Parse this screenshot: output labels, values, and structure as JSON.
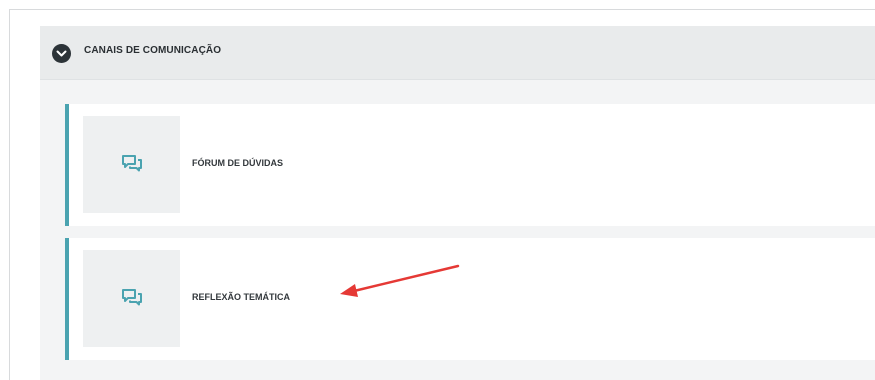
{
  "section": {
    "title": "CANAIS DE COMUNICAÇÃO",
    "toggle_icon": "chevron-down-icon"
  },
  "items": [
    {
      "label": "FÓRUM DE DÚVIDAS",
      "icon": "chat-bubbles-icon"
    },
    {
      "label": "REFLEXÃO TEMÁTICA",
      "icon": "chat-bubbles-icon"
    }
  ],
  "annotation": {
    "icon": "red-arrow",
    "color": "#e53935"
  },
  "colors": {
    "accent": "#4aa3b0",
    "header_bg": "#e9ebec",
    "toggle_bg": "#2c3338"
  }
}
